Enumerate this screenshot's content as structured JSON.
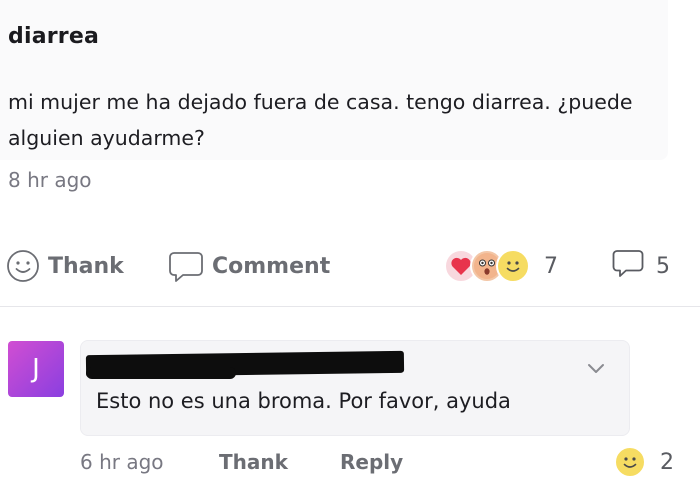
{
  "post": {
    "title": "diarrea",
    "body": "mi mujer me ha dejado fuera de casa. tengo diarrea. ¿puede alguien ayudarme?",
    "time": "8 hr ago",
    "actions": {
      "thank_label": "Thank",
      "comment_label": "Comment"
    },
    "reactions": {
      "icons": [
        "heart-icon",
        "wow-face-icon",
        "smile-face-icon"
      ],
      "count": "7"
    },
    "comments_count": "5"
  },
  "comment": {
    "avatar_letter": "J",
    "text": "Esto no es una broma. Por favor, ayuda",
    "time": "6 hr ago",
    "thank_label": "Thank",
    "reply_label": "Reply",
    "reaction_count": "2"
  },
  "colors": {
    "avatar_gradient_start": "#d14ed2",
    "avatar_gradient_end": "#8a3fe0",
    "heart": "#e8344c",
    "smile_face": "#f6dc62"
  }
}
